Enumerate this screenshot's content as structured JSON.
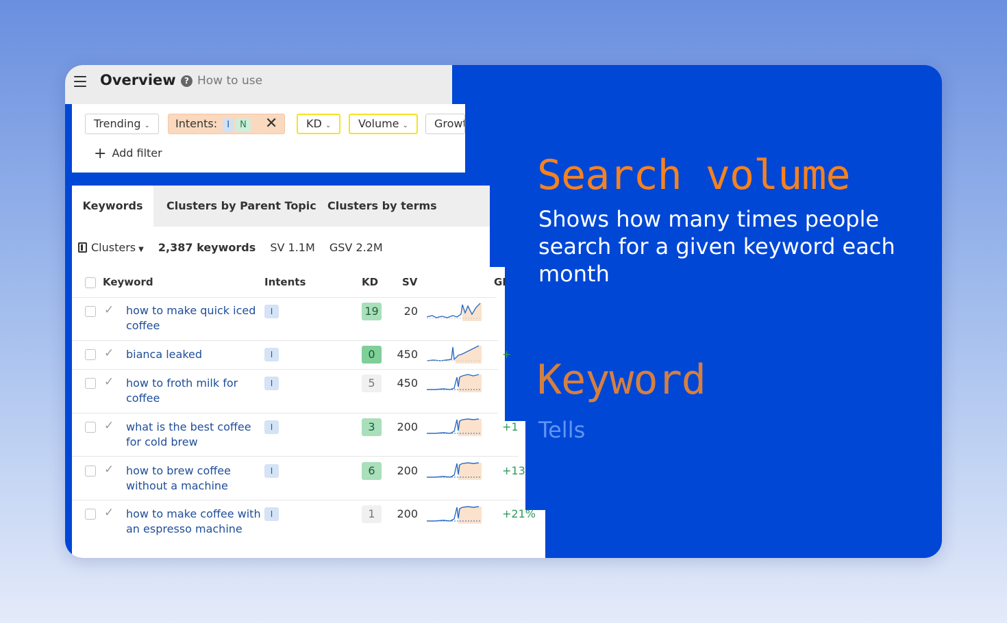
{
  "header": {
    "title": "Overview",
    "help_label": "How to use"
  },
  "filters": {
    "trending": "Trending",
    "intents_label": "Intents:",
    "intent_i": "I",
    "intent_n": "N",
    "kd": "KD",
    "volume": "Volume",
    "growth": "Growt",
    "add_filter": "Add filter"
  },
  "tabs": [
    {
      "label": "Keywords"
    },
    {
      "label": "Clusters by Parent Topic"
    },
    {
      "label": "Clusters by terms"
    }
  ],
  "summary": {
    "clusters": "Clusters",
    "keywords": "2,387 keywords",
    "sv": "SV 1.1M",
    "gsv": "GSV 2.2M"
  },
  "table": {
    "columns": [
      "Keyword",
      "Intents",
      "KD",
      "SV",
      "GI"
    ],
    "rows": [
      {
        "keyword": "how to make quick iced coffee",
        "intent": "I",
        "kd": "19",
        "sv": "20",
        "growth": ""
      },
      {
        "keyword": "bianca leaked",
        "intent": "I",
        "kd": "0",
        "sv": "450",
        "growth": "+"
      },
      {
        "keyword": "how to froth milk for coffee",
        "intent": "I",
        "kd": "5",
        "sv": "450",
        "growth": ""
      },
      {
        "keyword": "what is the best coffee for cold brew",
        "intent": "I",
        "kd": "3",
        "sv": "200",
        "growth": "+1"
      },
      {
        "keyword": "how to brew coffee without a machine",
        "intent": "I",
        "kd": "6",
        "sv": "200",
        "growth": "+13"
      },
      {
        "keyword": "how to make coffee with an espresso machine",
        "intent": "I",
        "kd": "1",
        "sv": "200",
        "growth": "+21%"
      }
    ]
  },
  "promo": {
    "title1": "Search volume",
    "desc1": "Shows how many times people search for a given keyword each month",
    "title2": "Keyword",
    "desc2": "Tells"
  },
  "colors": {
    "blue_panel": "#0047d6",
    "accent_orange": "#f58220",
    "highlight_yellow": "#f8e31d",
    "link_blue": "#1f4d99"
  }
}
